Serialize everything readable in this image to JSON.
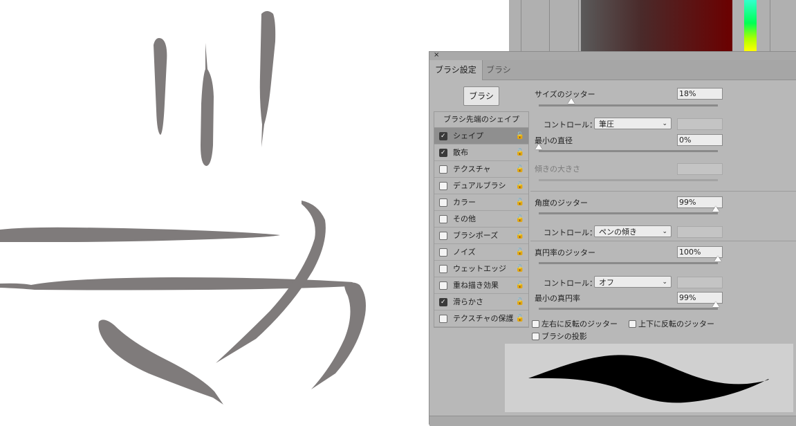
{
  "panel": {
    "close_glyph": "×",
    "tabs": [
      "ブラシ設定",
      "ブラシ"
    ],
    "preset_button": "ブラシ",
    "list_header": "ブラシ先端のシェイプ",
    "items": [
      {
        "label": "シェイプ",
        "checked": true,
        "selected": true
      },
      {
        "label": "散布",
        "checked": true,
        "selected": false
      },
      {
        "label": "テクスチャ",
        "checked": false,
        "selected": false
      },
      {
        "label": "デュアルブラシ",
        "checked": false,
        "selected": false
      },
      {
        "label": "カラー",
        "checked": false,
        "selected": false
      },
      {
        "label": "その他",
        "checked": false,
        "selected": false
      },
      {
        "label": "ブラシポーズ",
        "checked": false,
        "selected": false
      },
      {
        "label": "ノイズ",
        "checked": false,
        "selected": false
      },
      {
        "label": "ウェットエッジ",
        "checked": false,
        "selected": false
      },
      {
        "label": "重ね描き効果",
        "checked": false,
        "selected": false
      },
      {
        "label": "滑らかさ",
        "checked": true,
        "selected": false
      },
      {
        "label": "テクスチャの保護",
        "checked": false,
        "selected": false
      }
    ],
    "lock_glyph": "🔓"
  },
  "settings": {
    "size_jitter": {
      "label": "サイズのジッター",
      "value": "18%",
      "slider": 0.18
    },
    "size_control": {
      "label": "コントロール：",
      "value": "筆圧"
    },
    "min_diameter": {
      "label": "最小の直径",
      "value": "0%",
      "slider": 0.0
    },
    "tilt_scale": {
      "label": "傾きの大きさ"
    },
    "angle_jitter": {
      "label": "角度のジッター",
      "value": "99%",
      "slider": 0.99
    },
    "angle_control": {
      "label": "コントロール：",
      "value": "ペンの傾き"
    },
    "roundness_jitter": {
      "label": "真円率のジッター",
      "value": "100%",
      "slider": 1.0
    },
    "roundness_control": {
      "label": "コントロール：",
      "value": "オフ"
    },
    "min_roundness": {
      "label": "最小の真円率",
      "value": "99%",
      "slider": 0.99
    },
    "flip_x": {
      "label": "左右に反転のジッター",
      "checked": false
    },
    "flip_y": {
      "label": "上下に反転のジッター",
      "checked": false
    },
    "projection": {
      "label": "ブラシの投影",
      "checked": false
    },
    "chevron_glyph": "⌄"
  },
  "colors": {
    "stroke": "#7f7b7b",
    "panel": "#b8b8b8",
    "preview_stroke": "#000000"
  }
}
